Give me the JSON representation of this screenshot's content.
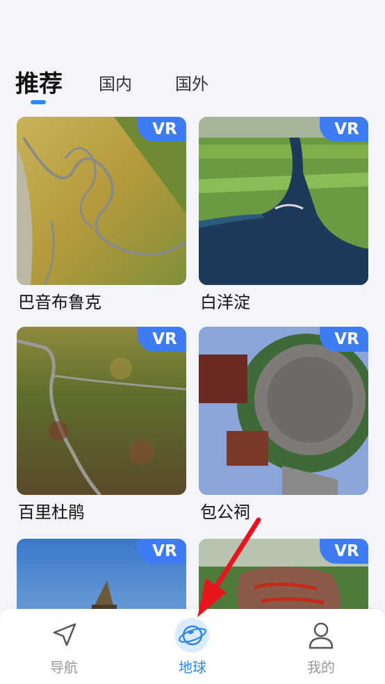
{
  "tabs": [
    {
      "label": "推荐",
      "active": true
    },
    {
      "label": "国内",
      "active": false
    },
    {
      "label": "国外",
      "active": false
    }
  ],
  "cards": [
    {
      "name": "巴音布鲁克",
      "badge": "VR"
    },
    {
      "name": "白洋淀",
      "badge": "VR"
    },
    {
      "name": "百里杜鹃",
      "badge": "VR"
    },
    {
      "name": "包公祠",
      "badge": "VR"
    },
    {
      "name": "",
      "badge": "VR"
    },
    {
      "name": "",
      "badge": "VR"
    }
  ],
  "bottom_nav": [
    {
      "label": "导航",
      "icon": "navigation-arrow-icon",
      "active": false
    },
    {
      "label": "地球",
      "icon": "globe-icon",
      "active": true
    },
    {
      "label": "我的",
      "icon": "user-icon",
      "active": false
    }
  ],
  "colors": {
    "accent": "#2f86f6",
    "vr_badge": "#3e7cf4",
    "background": "#f4f5f8"
  }
}
